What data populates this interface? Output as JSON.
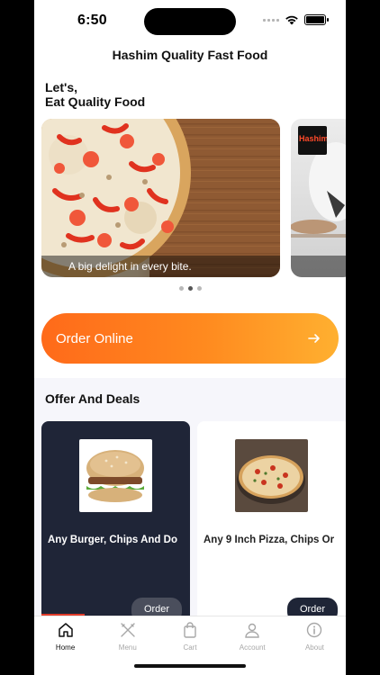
{
  "status_bar": {
    "time": "6:50"
  },
  "header": {
    "title": "Hashim Quality Fast Food"
  },
  "greeting": {
    "line1": "Let's,",
    "line2": "Eat Quality Food"
  },
  "carousel": {
    "slides": [
      {
        "caption": "A big delight in every bite."
      },
      {
        "logo_text": "Hashim"
      }
    ],
    "active_index": 1,
    "dot_count": 3
  },
  "order_online": {
    "label": "Order Online",
    "icon": "arrow-right-icon"
  },
  "offers": {
    "title": "Offer And Deals",
    "deals": [
      {
        "name": "Any Burger, Chips And Do",
        "button": "Order"
      },
      {
        "name": "Any 9 Inch Pizza, Chips Or",
        "button": "Order"
      }
    ]
  },
  "tab_bar": {
    "items": [
      {
        "label": "Home",
        "icon": "home-icon",
        "active": true
      },
      {
        "label": "Menu",
        "icon": "utensils-icon",
        "active": false
      },
      {
        "label": "Cart",
        "icon": "shopping-bag-icon",
        "active": false
      },
      {
        "label": "Account",
        "icon": "user-icon",
        "active": false
      },
      {
        "label": "About",
        "icon": "info-icon",
        "active": false
      }
    ]
  },
  "colors": {
    "accent_start": "#ff6a1a",
    "accent_end": "#ffb030",
    "dark_card": "#1f2537"
  }
}
